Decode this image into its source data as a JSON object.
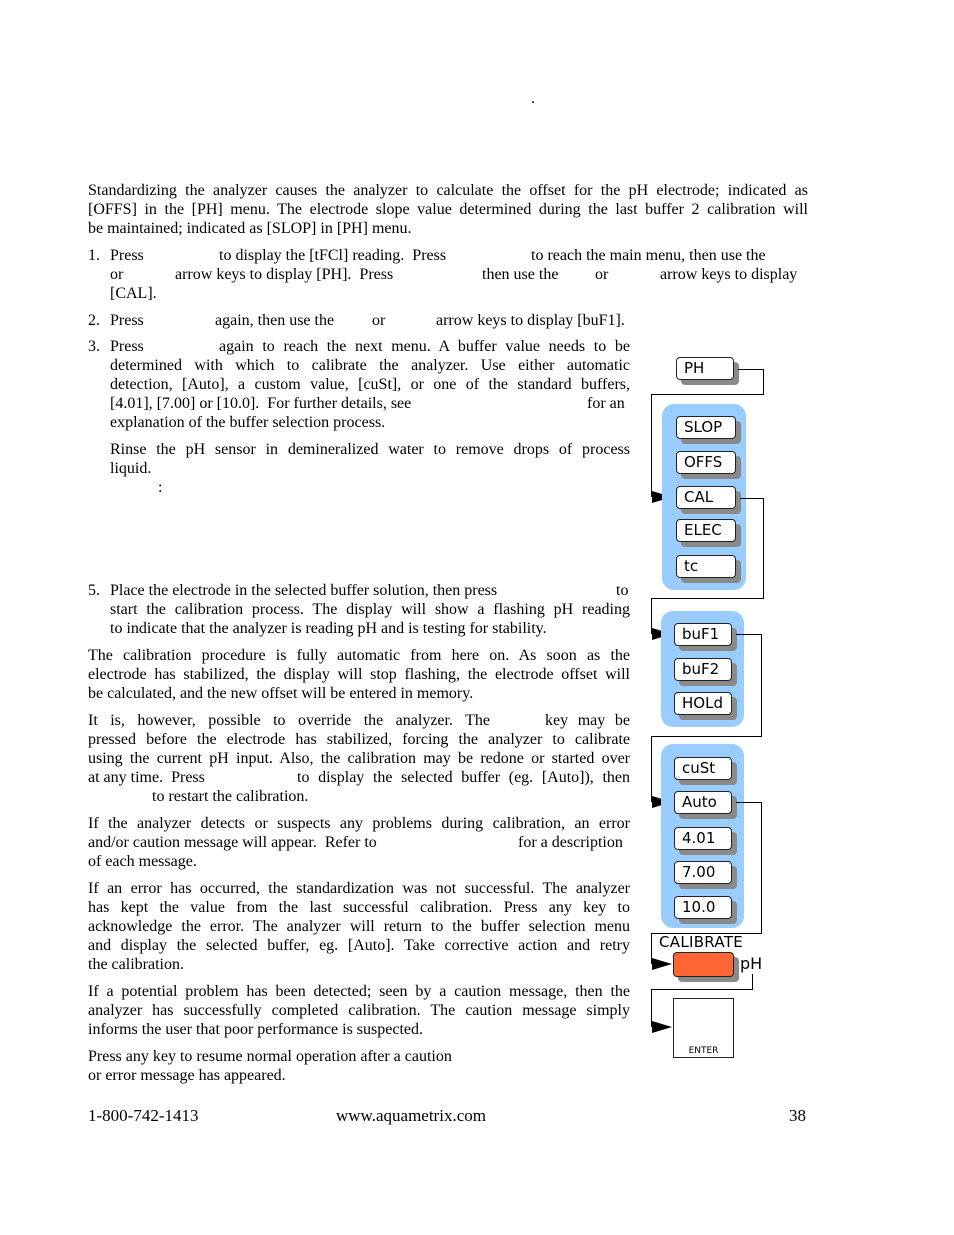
{
  "header": {
    "dot": "."
  },
  "intro": [
    "Standardizing the analyzer causes the analyzer to calculate the offset for the pH electrode; indicated as",
    "[OFFS] in the [PH] menu.  The electrode slope value determined during the last buffer 2 calibration will",
    "be maintained; indicated as [SLOP] in [PH] menu."
  ],
  "steps": {
    "s1": {
      "num": "1.",
      "l1a": "Press",
      "l1b": "to display the [tFCl] reading.  Press",
      "l1c": "to reach the main menu, then use the",
      "l2a": "or",
      "l2b": "arrow keys to display [PH].  Press",
      "l2c": "then use the",
      "l2d": "or",
      "l2e": "arrow keys to display",
      "l3": "[CAL]."
    },
    "s2": {
      "num": "2.",
      "a": "Press",
      "b": "again, then use the",
      "c": "or",
      "d": "arrow keys to display [buF1]."
    },
    "s3": {
      "num": "3.",
      "l1a": "Press",
      "l1b": "again to reach the next menu.  A buffer value needs to be",
      "l2": "determined with which to calibrate the analyzer.  Use either automatic",
      "l3": "detection, [Auto], a custom value, [cuSt], or one of the standard buffers,",
      "l4a": "[4.01], [7.00] or [10.0].  For further details, see",
      "l4b": "for an",
      "l5": "explanation of the buffer selection process.",
      "r1": "Rinse the pH sensor in demineralized water to remove drops of process",
      "r2": "liquid.",
      "colon": ":"
    },
    "s5": {
      "num": "5.",
      "l1a": "Place the electrode in the selected buffer solution, then press",
      "l1b": "to",
      "l2": "start the calibration process.  The display will show a flashing pH reading",
      "l3": "to indicate that the analyzer is reading pH and is testing for stability."
    }
  },
  "paragraphs": {
    "p1": [
      "The calibration procedure is fully automatic from here on.  As soon as the",
      "electrode has stabilized, the display will stop flashing, the electrode offset will",
      "be calculated, and the new offset will be entered in memory."
    ],
    "p2": {
      "l1a": "It is, however, possible to override the analyzer.  The",
      "l1b": "key may be",
      "l2": "pressed before the electrode has stabilized, forcing the analyzer to calibrate",
      "l3": "using the current pH input.  Also, the calibration may be redone or started over",
      "l4a": "at any time.  Press",
      "l4b": "to display the selected buffer (eg. [Auto]), then",
      "l5": "to restart the calibration."
    },
    "p3": {
      "l1": "If the analyzer detects or suspects any problems during calibration, an error",
      "l2a": "and/or caution message will appear.  Refer to",
      "l2b": "for a description",
      "l3": "of each message."
    },
    "p4": [
      "If an error has occurred, the standardization was not successful.  The analyzer",
      "has kept the value from the last successful calibration.  Press any key to",
      "acknowledge the error.  The analyzer will return to the buffer selection menu",
      "and display the selected buffer, eg. [Auto].  Take corrective action and retry",
      "the calibration."
    ],
    "p5": [
      "If a potential problem has been detected; seen by a caution message, then the",
      "analyzer has successfully completed calibration.  The caution message simply",
      "informs the user that poor performance is suspected."
    ],
    "p6": [
      "Press any key to resume normal operation after a caution",
      "or error message has appeared."
    ]
  },
  "diagram": {
    "top_menu": "PH",
    "ph_menu": [
      "SLOP",
      "OFFS",
      "CAL",
      "ELEC",
      "tc"
    ],
    "cal_menu": [
      "buF1",
      "buF2",
      "HOLd"
    ],
    "buffer_menu": [
      "cuSt",
      "Auto",
      "4.01",
      "7.00",
      "10.0"
    ],
    "calibrate_label": "CALIBRATE",
    "unit_label": "pH",
    "enter_label": "ENTER",
    "display_color": "#ff6633",
    "panel_color": "#99ccff"
  },
  "footer": {
    "phone": "1-800-742-1413",
    "website": "www.aquametrix.com",
    "page": "38"
  }
}
